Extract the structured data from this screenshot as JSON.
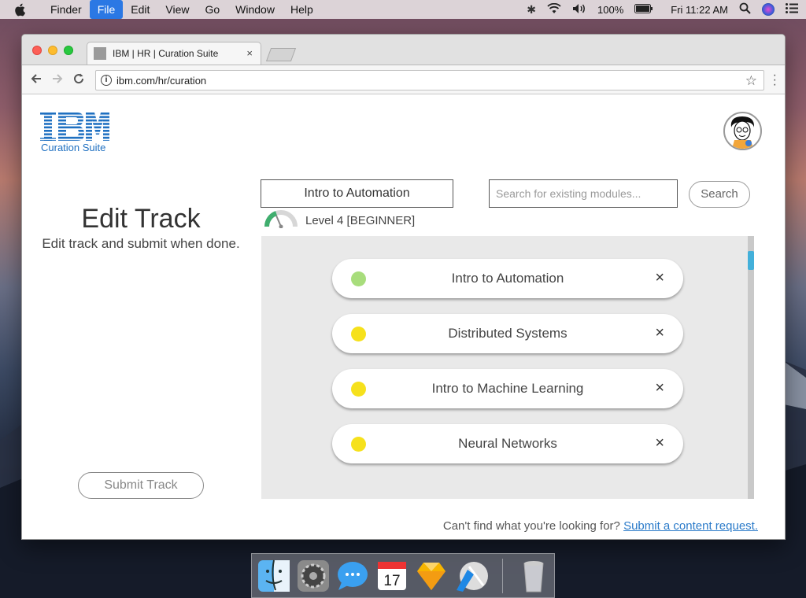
{
  "menubar": {
    "items": [
      "Finder",
      "File",
      "Edit",
      "View",
      "Go",
      "Window",
      "Help"
    ],
    "active_index": 1,
    "battery": "100%",
    "clock": "Fri 11:22 AM"
  },
  "browser": {
    "tab_title": "IBM | HR | Curation Suite",
    "tab_close": "×",
    "url": "ibm.com/hr/curation"
  },
  "page": {
    "logo_sub": "Curation Suite",
    "title": "Edit Track",
    "subtitle": "Edit track and submit when done.",
    "submit_label": "Submit Track",
    "track_name": "Intro to Automation",
    "level": "Level 4 [BEGINNER]",
    "search_placeholder": "Search for existing modules...",
    "search_label": "Search",
    "modules": [
      {
        "label": "Intro to Automation",
        "status_color": "#a8dd7c"
      },
      {
        "label": "Distributed Systems",
        "status_color": "#f6e11c"
      },
      {
        "label": "Intro to Machine Learning",
        "status_color": "#f6e11c"
      },
      {
        "label": "Neural Networks",
        "status_color": "#f6e11c"
      }
    ],
    "remove_glyph": "×",
    "footer_text": "Can't find what you're looking for?",
    "footer_link": "Submit a content request."
  },
  "colors": {
    "ibm_blue": "#1f70c1",
    "accent": "#43b0da"
  },
  "dock": {
    "calendar_day": "17",
    "icons": [
      "finder-icon",
      "system-preferences-icon",
      "messages-icon",
      "calendar-icon",
      "sketch-icon",
      "xcode-icon",
      "trash-icon"
    ]
  }
}
